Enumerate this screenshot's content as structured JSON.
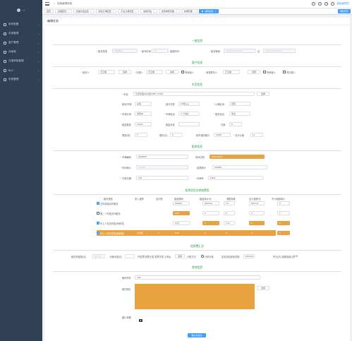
{
  "sidebar": {
    "logo": "...",
    "items": [
      {
        "label": "用车配置"
      },
      {
        "label": "车型管理"
      },
      {
        "label": "客户管理"
      },
      {
        "label": "对接单"
      },
      {
        "label": "日报审核管理"
      },
      {
        "label": "BUY"
      },
      {
        "label": "系统管理"
      }
    ]
  },
  "topbar": {
    "breadcrumb_home": "首页",
    "breadcrumb_current": "线索管理系统",
    "admin": "超级管理员"
  },
  "tabs": [
    {
      "label": "首页"
    },
    {
      "label": "基础配置"
    },
    {
      "label": "基础价格设置"
    },
    {
      "label": "新建订单配置"
    },
    {
      "label": "平台订单配置"
    },
    {
      "label": "信用评估"
    },
    {
      "label": "线索审核管理"
    },
    {
      "label": "车辆管理"
    },
    {
      "label": "编辑任务"
    }
  ],
  "tab_right": "刷新所有",
  "card_title": "编辑任务",
  "sections": {
    "basic": "一般信息",
    "customer": "客户信息",
    "car": "车型信息",
    "rent": "租赁信息",
    "fee": "租赁项目名称和费用",
    "total": "租赁费汇总",
    "other": "其他信息"
  },
  "basic": {
    "type_label": "租赁类型",
    "type_value": "长租租赁",
    "days_label": "租车时间",
    "days_value": "12",
    "unit": "租期时间",
    "period_label": "租赁期间",
    "period_start": "2023-05-20 10:00",
    "period_sep": "至",
    "period_end": "2023-06-20 10:00"
  },
  "customer": {
    "name_label": "租赁人",
    "name_value": "王五福",
    "select1": "选择",
    "agent_label": "办理人",
    "agent_value": "王五福",
    "select2": "选择",
    "same_label": "同承租人",
    "contact_label": "紧急联系人",
    "contact_value": "王五福",
    "select3": "选择",
    "same2_label": "同承租人",
    "same3_label": "同办理人"
  },
  "car": {
    "model_label": "车型",
    "model_value": "东风标致2023款4008 1.6THP",
    "select": "选择",
    "color_label": "颜色/内饰",
    "color_value": "白色",
    "tag_label": "部分车型",
    "tag_value": "10吨以上",
    "gear_label": "价格区间",
    "gear_value": "自营",
    "source_label": "车源分类",
    "source_value": "商务车",
    "quota_label": "车辆信息",
    "quota_value": "个人信息",
    "brand_label": "租赁信息",
    "brand_value": "商业",
    "guide_label": "租金数量",
    "guide_value": "10000",
    "deposit_label": "租金月费",
    "mileage_label": "日期",
    "mileage_value": "8",
    "limit_label": "限重(吨)",
    "limit_value": "5",
    "times_label": "限时(天)",
    "times_value": "0",
    "nb_label": "新车保险累计",
    "nb_value": "10000",
    "overdue_label": "总计价格",
    "overdue_value": "11"
  },
  "rent": {
    "vin_label": "车辆编码",
    "vin_value": "2000000",
    "start_label": "时间日期",
    "start_value": "2023-06-20",
    "from_label": "时间单价",
    "from_value": "100000",
    "amount_label": "金额统计",
    "amount_value": "220000",
    "pay_label": "付款日期",
    "pay_value": "100",
    "plate_label": "车牌号",
    "plate_value": "11111"
  },
  "fee": {
    "headers": [
      "租赁类型",
      "收入金额",
      "自行配",
      "租金期间",
      "租金单价/元",
      "调整系数",
      "合计金额/元",
      "不计免赔单价"
    ],
    "rows": [
      {
        "name": "日内单独合作租赁",
        "checked": true,
        "c1": "220000",
        "c2": "2023.05",
        "c3": "2.2",
        "c4": "8110.11",
        "c5": "0"
      },
      {
        "name": "第二个车型合作租赁",
        "checked": false,
        "c1": "0.00",
        "c2": "0",
        "c3": "0",
        "c4": "0",
        "c5": "1"
      },
      {
        "name": "车上人员责任险(驾驶员)",
        "checked": true,
        "c1": "10万",
        "c2": "0",
        "c3": "2.11",
        "c4": "0",
        "c5": "0"
      },
      {
        "name": "车上人员责任险(乘客险)",
        "checked": true,
        "c0": "5万/座",
        "c0b": "1",
        "c1": "0.00",
        "c2": "0",
        "c3": "0",
        "c4": "0",
        "c5": "0"
      }
    ]
  },
  "total": {
    "deposit_label": "租赁押金额(元)",
    "deposit_value": "500.00",
    "discount_label": "价格优惠(元)",
    "discount_value": "",
    "invoice_label": "开发票/发票已收",
    "invoice_opt1": "发票开具/上传后",
    "select": "选择",
    "other_label": "计税方法",
    "radio1": "计税计费",
    "grand_label": "实际出险费用总额",
    "grand_value": "2023.05",
    "ins_label": "时元(元) 保额费用(元)",
    "ins_value": "0.00"
  },
  "other": {
    "remark_label": "随车附件",
    "remark_value": "1111",
    "pic_label": "租赁照片",
    "select": "选择",
    "img_label": "图片单据"
  },
  "submit": "确认并提交",
  "colors": {
    "sidebar": "#304156",
    "accent": "#409eff",
    "highlight": "#e8a23f",
    "section": "#1e9e4a"
  }
}
